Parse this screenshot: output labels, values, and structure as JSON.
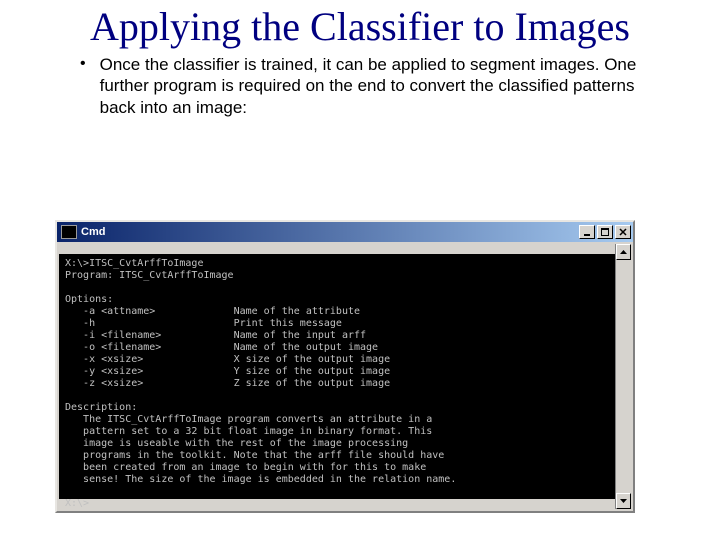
{
  "slide": {
    "title": "Applying the Classifier to Images",
    "bullet": "Once the classifier is trained, it can be applied to segment images. One further program is required on the end to convert the classified patterns back into an image:"
  },
  "cmd": {
    "window_title": "Cmd",
    "lines": [
      "X:\\>ITSC_CvtArffToImage",
      "Program: ITSC_CvtArffToImage",
      "",
      "Options:",
      "   -a <attname>             Name of the attribute",
      "   -h                       Print this message",
      "   -i <filename>            Name of the input arff",
      "   -o <filename>            Name of the output image",
      "   -x <xsize>               X size of the output image",
      "   -y <xsize>               Y size of the output image",
      "   -z <xsize>               Z size of the output image",
      "",
      "Description:",
      "   The ITSC_CvtArffToImage program converts an attribute in a",
      "   pattern set to a 32 bit float image in binary format. This",
      "   image is useable with the rest of the image processing",
      "   programs in the toolkit. Note that the arff file should have",
      "   been created from an image to begin with for this to make",
      "   sense! The size of the image is embedded in the relation name.",
      "",
      "X:\\>"
    ]
  }
}
